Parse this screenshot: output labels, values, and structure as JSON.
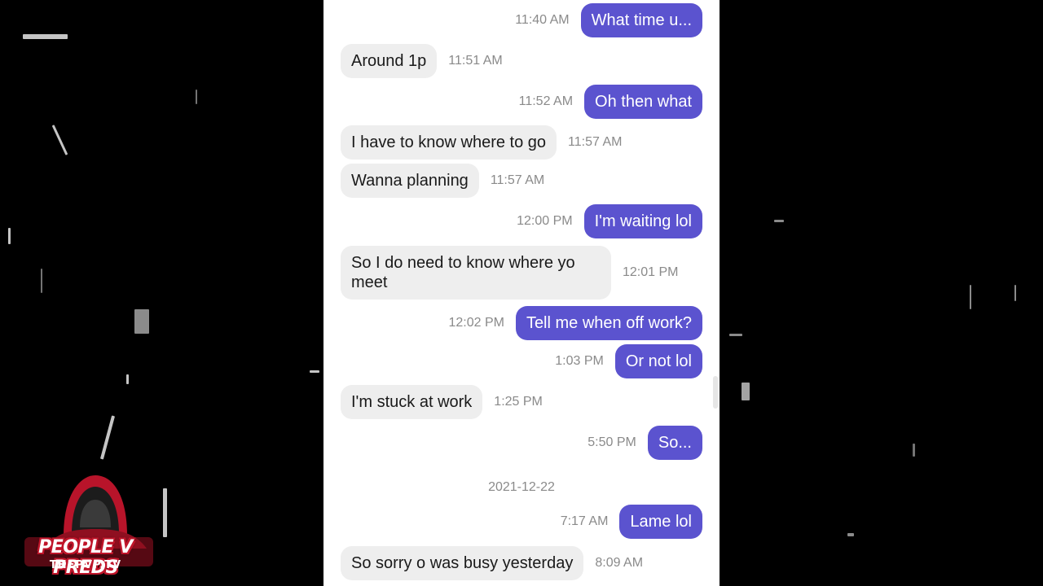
{
  "colors": {
    "outgoing_bubble": "#5b53cf",
    "incoming_bubble": "#eeeeee",
    "timestamp": "#8a8a8a",
    "panel": "#ffffff",
    "backdrop": "#000000"
  },
  "messages": [
    {
      "direction": "out",
      "text": "What time u...",
      "time": "11:40 AM"
    },
    {
      "direction": "in",
      "text": "Around 1p",
      "time": "11:51 AM"
    },
    {
      "direction": "out",
      "text": "Oh then what",
      "time": "11:52 AM"
    },
    {
      "direction": "in",
      "text": "I have to know where to go",
      "time": "11:57 AM"
    },
    {
      "direction": "in",
      "text": "Wanna planning",
      "time": "11:57 AM"
    },
    {
      "direction": "out",
      "text": "I'm waiting lol",
      "time": "12:00 PM"
    },
    {
      "direction": "in",
      "text": "So I do need to know where yo meet",
      "time": "12:01 PM"
    },
    {
      "direction": "out",
      "text": "Tell me when off work?",
      "time": "12:02 PM"
    },
    {
      "direction": "out",
      "text": "Or not lol",
      "time": "1:03 PM"
    },
    {
      "direction": "in",
      "text": "I'm stuck at work",
      "time": "1:25 PM"
    },
    {
      "direction": "out",
      "text": "So...",
      "time": "5:50 PM"
    },
    {
      "direction": "out",
      "text": "Lame lol",
      "time": "7:17 AM"
    },
    {
      "direction": "in",
      "text": "So sorry o was busy yesterday",
      "time": "8:09 AM"
    }
  ],
  "date_separator": "2021-12-22",
  "logo": {
    "title": "PEOPLE V PREDS",
    "subtitle": "THEPVP.TV",
    "icon": "hooded-figure-icon"
  }
}
